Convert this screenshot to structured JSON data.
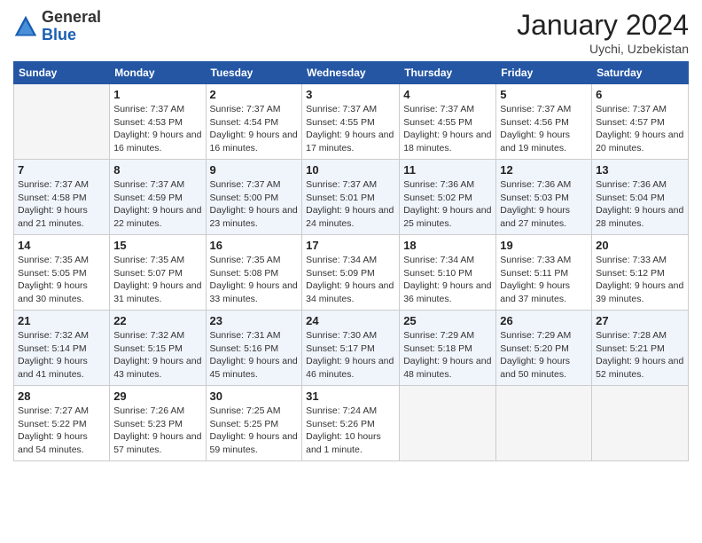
{
  "header": {
    "logo_line1": "General",
    "logo_line2": "Blue",
    "month_title": "January 2024",
    "subtitle": "Uychi, Uzbekistan"
  },
  "columns": [
    "Sunday",
    "Monday",
    "Tuesday",
    "Wednesday",
    "Thursday",
    "Friday",
    "Saturday"
  ],
  "weeks": [
    [
      {
        "day": "",
        "empty": true
      },
      {
        "day": "1",
        "sunrise": "Sunrise: 7:37 AM",
        "sunset": "Sunset: 4:53 PM",
        "daylight": "Daylight: 9 hours and 16 minutes."
      },
      {
        "day": "2",
        "sunrise": "Sunrise: 7:37 AM",
        "sunset": "Sunset: 4:54 PM",
        "daylight": "Daylight: 9 hours and 16 minutes."
      },
      {
        "day": "3",
        "sunrise": "Sunrise: 7:37 AM",
        "sunset": "Sunset: 4:55 PM",
        "daylight": "Daylight: 9 hours and 17 minutes."
      },
      {
        "day": "4",
        "sunrise": "Sunrise: 7:37 AM",
        "sunset": "Sunset: 4:55 PM",
        "daylight": "Daylight: 9 hours and 18 minutes."
      },
      {
        "day": "5",
        "sunrise": "Sunrise: 7:37 AM",
        "sunset": "Sunset: 4:56 PM",
        "daylight": "Daylight: 9 hours and 19 minutes."
      },
      {
        "day": "6",
        "sunrise": "Sunrise: 7:37 AM",
        "sunset": "Sunset: 4:57 PM",
        "daylight": "Daylight: 9 hours and 20 minutes."
      }
    ],
    [
      {
        "day": "7",
        "sunrise": "Sunrise: 7:37 AM",
        "sunset": "Sunset: 4:58 PM",
        "daylight": "Daylight: 9 hours and 21 minutes."
      },
      {
        "day": "8",
        "sunrise": "Sunrise: 7:37 AM",
        "sunset": "Sunset: 4:59 PM",
        "daylight": "Daylight: 9 hours and 22 minutes."
      },
      {
        "day": "9",
        "sunrise": "Sunrise: 7:37 AM",
        "sunset": "Sunset: 5:00 PM",
        "daylight": "Daylight: 9 hours and 23 minutes."
      },
      {
        "day": "10",
        "sunrise": "Sunrise: 7:37 AM",
        "sunset": "Sunset: 5:01 PM",
        "daylight": "Daylight: 9 hours and 24 minutes."
      },
      {
        "day": "11",
        "sunrise": "Sunrise: 7:36 AM",
        "sunset": "Sunset: 5:02 PM",
        "daylight": "Daylight: 9 hours and 25 minutes."
      },
      {
        "day": "12",
        "sunrise": "Sunrise: 7:36 AM",
        "sunset": "Sunset: 5:03 PM",
        "daylight": "Daylight: 9 hours and 27 minutes."
      },
      {
        "day": "13",
        "sunrise": "Sunrise: 7:36 AM",
        "sunset": "Sunset: 5:04 PM",
        "daylight": "Daylight: 9 hours and 28 minutes."
      }
    ],
    [
      {
        "day": "14",
        "sunrise": "Sunrise: 7:35 AM",
        "sunset": "Sunset: 5:05 PM",
        "daylight": "Daylight: 9 hours and 30 minutes."
      },
      {
        "day": "15",
        "sunrise": "Sunrise: 7:35 AM",
        "sunset": "Sunset: 5:07 PM",
        "daylight": "Daylight: 9 hours and 31 minutes."
      },
      {
        "day": "16",
        "sunrise": "Sunrise: 7:35 AM",
        "sunset": "Sunset: 5:08 PM",
        "daylight": "Daylight: 9 hours and 33 minutes."
      },
      {
        "day": "17",
        "sunrise": "Sunrise: 7:34 AM",
        "sunset": "Sunset: 5:09 PM",
        "daylight": "Daylight: 9 hours and 34 minutes."
      },
      {
        "day": "18",
        "sunrise": "Sunrise: 7:34 AM",
        "sunset": "Sunset: 5:10 PM",
        "daylight": "Daylight: 9 hours and 36 minutes."
      },
      {
        "day": "19",
        "sunrise": "Sunrise: 7:33 AM",
        "sunset": "Sunset: 5:11 PM",
        "daylight": "Daylight: 9 hours and 37 minutes."
      },
      {
        "day": "20",
        "sunrise": "Sunrise: 7:33 AM",
        "sunset": "Sunset: 5:12 PM",
        "daylight": "Daylight: 9 hours and 39 minutes."
      }
    ],
    [
      {
        "day": "21",
        "sunrise": "Sunrise: 7:32 AM",
        "sunset": "Sunset: 5:14 PM",
        "daylight": "Daylight: 9 hours and 41 minutes."
      },
      {
        "day": "22",
        "sunrise": "Sunrise: 7:32 AM",
        "sunset": "Sunset: 5:15 PM",
        "daylight": "Daylight: 9 hours and 43 minutes."
      },
      {
        "day": "23",
        "sunrise": "Sunrise: 7:31 AM",
        "sunset": "Sunset: 5:16 PM",
        "daylight": "Daylight: 9 hours and 45 minutes."
      },
      {
        "day": "24",
        "sunrise": "Sunrise: 7:30 AM",
        "sunset": "Sunset: 5:17 PM",
        "daylight": "Daylight: 9 hours and 46 minutes."
      },
      {
        "day": "25",
        "sunrise": "Sunrise: 7:29 AM",
        "sunset": "Sunset: 5:18 PM",
        "daylight": "Daylight: 9 hours and 48 minutes."
      },
      {
        "day": "26",
        "sunrise": "Sunrise: 7:29 AM",
        "sunset": "Sunset: 5:20 PM",
        "daylight": "Daylight: 9 hours and 50 minutes."
      },
      {
        "day": "27",
        "sunrise": "Sunrise: 7:28 AM",
        "sunset": "Sunset: 5:21 PM",
        "daylight": "Daylight: 9 hours and 52 minutes."
      }
    ],
    [
      {
        "day": "28",
        "sunrise": "Sunrise: 7:27 AM",
        "sunset": "Sunset: 5:22 PM",
        "daylight": "Daylight: 9 hours and 54 minutes."
      },
      {
        "day": "29",
        "sunrise": "Sunrise: 7:26 AM",
        "sunset": "Sunset: 5:23 PM",
        "daylight": "Daylight: 9 hours and 57 minutes."
      },
      {
        "day": "30",
        "sunrise": "Sunrise: 7:25 AM",
        "sunset": "Sunset: 5:25 PM",
        "daylight": "Daylight: 9 hours and 59 minutes."
      },
      {
        "day": "31",
        "sunrise": "Sunrise: 7:24 AM",
        "sunset": "Sunset: 5:26 PM",
        "daylight": "Daylight: 10 hours and 1 minute."
      },
      {
        "day": "",
        "empty": true
      },
      {
        "day": "",
        "empty": true
      },
      {
        "day": "",
        "empty": true
      }
    ]
  ]
}
